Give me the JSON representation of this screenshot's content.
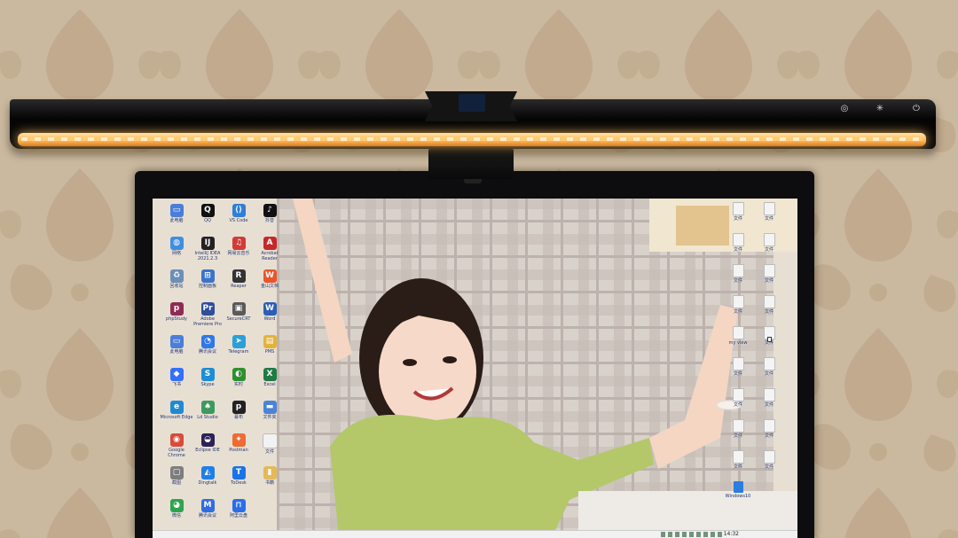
{
  "scene": {
    "colors": {
      "wallpaper": "#c9b79d",
      "lamp_body": "#0d0d0d",
      "lamp_light": "#ffb452",
      "monitor_bezel": "#0d0d0f",
      "taskbar": "#f1f1f1"
    }
  },
  "lamp": {
    "buttons": [
      {
        "icon": "mode-icon",
        "glyph": "◎"
      },
      {
        "icon": "brightness-icon",
        "glyph": "✳"
      },
      {
        "icon": "power-icon",
        "glyph": "⏻"
      }
    ]
  },
  "desktop": {
    "left_icons": [
      {
        "label": "此电脑",
        "icon": "computer-icon",
        "color": "#4a7ed8",
        "glyph": "▭"
      },
      {
        "label": "QQ",
        "icon": "qq-icon",
        "color": "#111111",
        "glyph": "Q"
      },
      {
        "label": "VS Code",
        "icon": "vscode-icon",
        "color": "#2f7fd6",
        "glyph": "⟨⟩"
      },
      {
        "label": "抖音",
        "icon": "tiktok-icon",
        "color": "#111111",
        "glyph": "♪"
      },
      {
        "label": "网络",
        "icon": "network-icon",
        "color": "#3f8ee0",
        "glyph": "◍"
      },
      {
        "label": "IntelliJ IDEA 2021.2.3",
        "icon": "intellij-icon",
        "color": "#222222",
        "glyph": "IJ"
      },
      {
        "label": "网易云音乐",
        "icon": "music-icon",
        "color": "#d33a3a",
        "glyph": "♫"
      },
      {
        "label": "Acrobat Reader",
        "icon": "acrobat-icon",
        "color": "#c62828",
        "glyph": "A"
      },
      {
        "label": "回收站",
        "icon": "recycle-bin-icon",
        "color": "#6c8fb5",
        "glyph": "♻"
      },
      {
        "label": "控制面板",
        "icon": "control-panel-icon",
        "color": "#3b73c9",
        "glyph": "⊞"
      },
      {
        "label": "Reaper",
        "icon": "reaper-icon",
        "color": "#333333",
        "glyph": "R"
      },
      {
        "label": "金山文档",
        "icon": "wps-docs-icon",
        "color": "#e9552b",
        "glyph": "W"
      },
      {
        "label": "phpStudy",
        "icon": "phpstudy-icon",
        "color": "#8e2b54",
        "glyph": "p"
      },
      {
        "label": "Adobe Premiere Pro",
        "icon": "premiere-icon",
        "color": "#2f4e9b",
        "glyph": "Pr"
      },
      {
        "label": "SecureCRT",
        "icon": "securecrt-icon",
        "color": "#5a5a5a",
        "glyph": "▣"
      },
      {
        "label": "Word",
        "icon": "word-icon",
        "color": "#2b5eb5",
        "glyph": "W"
      },
      {
        "label": "此电脑",
        "icon": "pc-icon",
        "color": "#4a7ed8",
        "glyph": "▭"
      },
      {
        "label": "腾讯会议",
        "icon": "meeting-icon",
        "color": "#2f78ea",
        "glyph": "◔"
      },
      {
        "label": "Telegram",
        "icon": "telegram-icon",
        "color": "#2aa0db",
        "glyph": "➤"
      },
      {
        "label": "PMS",
        "icon": "pms-icon",
        "color": "#e2b33c",
        "glyph": "▤"
      },
      {
        "label": "飞书",
        "icon": "feishu-icon",
        "color": "#3370ff",
        "glyph": "◆"
      },
      {
        "label": "Skype",
        "icon": "skype-icon",
        "color": "#1b8ed6",
        "glyph": "S"
      },
      {
        "label": "实时",
        "icon": "realtime-icon",
        "color": "#2f8f2f",
        "glyph": "◐"
      },
      {
        "label": "Excel",
        "icon": "excel-icon",
        "color": "#1f7a45",
        "glyph": "X"
      },
      {
        "label": "Microsoft Edge",
        "icon": "edge-icon",
        "color": "#1f8ad1",
        "glyph": "e"
      },
      {
        "label": "Ld Studio",
        "icon": "ld-studio-icon",
        "color": "#3d9a5d",
        "glyph": "♠"
      },
      {
        "label": "幕布",
        "icon": "mubu-icon",
        "color": "#222222",
        "glyph": "p"
      },
      {
        "label": "文件夹",
        "icon": "folder-icon",
        "color": "#4a84d8",
        "glyph": "▬"
      },
      {
        "label": "Google Chrome",
        "icon": "chrome-icon",
        "color": "#d84b3a",
        "glyph": "◉"
      },
      {
        "label": "Eclipse IDE",
        "icon": "eclipse-icon",
        "color": "#2c2255",
        "glyph": "◒"
      },
      {
        "label": "Postman",
        "icon": "postman-icon",
        "color": "#ef6b32",
        "glyph": "✦"
      },
      {
        "label": "文件",
        "icon": "file-icon",
        "color": "#f2f2f2",
        "glyph": ""
      },
      {
        "label": "截图",
        "icon": "screenshot-icon",
        "color": "#7d7d7d",
        "glyph": "▢"
      },
      {
        "label": "Dingtalk",
        "icon": "dingtalk-icon",
        "color": "#1f7fe6",
        "glyph": "◭"
      },
      {
        "label": "ToDesk",
        "icon": "todesk-icon",
        "color": "#1a73e8",
        "glyph": "T"
      },
      {
        "label": "书籍",
        "icon": "book-icon",
        "color": "#e5b858",
        "glyph": "▮"
      },
      {
        "label": "微信",
        "icon": "wechat-icon",
        "color": "#2ea44f",
        "glyph": "◕"
      },
      {
        "label": "腾讯会议",
        "icon": "tencent-meeting-icon",
        "color": "#2f6de0",
        "glyph": "M"
      },
      {
        "label": "阿里云盘",
        "icon": "aliyun-drive-icon",
        "color": "#2a6ee8",
        "glyph": "⊓"
      }
    ],
    "right_icons": [
      {
        "label": "文件",
        "icon": "file-icon"
      },
      {
        "label": "文件",
        "icon": "file-icon"
      },
      {
        "label": "文件",
        "icon": "file-icon"
      },
      {
        "label": "文件",
        "icon": "file-icon"
      },
      {
        "label": "文件",
        "icon": "file-icon"
      },
      {
        "label": "文件",
        "icon": "file-icon"
      },
      {
        "label": "文件",
        "icon": "file-icon"
      },
      {
        "label": "文件",
        "icon": "file-icon"
      },
      {
        "label": "my view",
        "icon": "file-icon"
      },
      {
        "label": "文件",
        "icon": "file-icon"
      },
      {
        "label": "文件",
        "icon": "file-icon"
      },
      {
        "label": "文件",
        "icon": "file-icon"
      },
      {
        "label": "文件",
        "icon": "file-icon"
      },
      {
        "label": "文件",
        "icon": "file-icon"
      },
      {
        "label": "文件",
        "icon": "file-icon"
      },
      {
        "label": "文件",
        "icon": "file-icon"
      },
      {
        "label": "文件",
        "icon": "file-icon"
      },
      {
        "label": "文件",
        "icon": "file-icon"
      },
      {
        "label": "Windows10",
        "icon": "windows-icon"
      }
    ]
  },
  "taskbar": {
    "clock": "14:32"
  }
}
